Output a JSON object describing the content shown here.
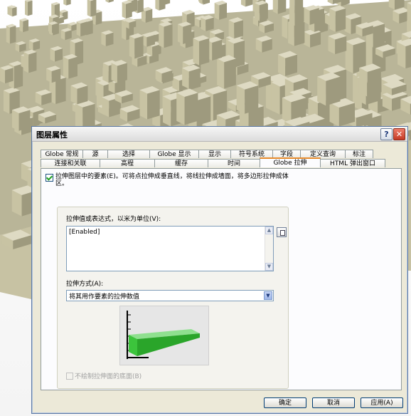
{
  "dialog": {
    "title": "图层属性",
    "help_label": "?",
    "close_label": "✕"
  },
  "tabs": {
    "top_row": [
      "Globe 常规",
      "源",
      "选择",
      "Globe 显示",
      "显示",
      "符号系统",
      "字段",
      "定义查询",
      "标注"
    ],
    "bottom_row": [
      "连接和关联",
      "高程",
      "缓存",
      "时间",
      "Globe 拉伸",
      "HTML 弹出窗口"
    ],
    "active": "Globe 拉伸"
  },
  "extrude": {
    "checkbox_label": "拉伸图层中的要素(E)。可将点拉伸成垂直线，将线拉伸成墙面，将多边形拉伸成体区。",
    "checked": true,
    "value_label": "拉伸值或表达式，以米为单位(V):",
    "value": "[Enabled]",
    "method_label": "拉伸方式(A):",
    "method_value": "将其用作要素的拉伸数值",
    "base_checkbox_label": "不绘制拉伸面的底面(B)",
    "base_checked": false
  },
  "buttons": {
    "ok": "确定",
    "cancel": "取消",
    "apply": "应用(A)"
  },
  "icons": {
    "expression": "expression-builder-icon",
    "scroll_up": "scroll-up-icon",
    "scroll_down": "scroll-down-icon",
    "dropdown": "chevron-down-icon"
  },
  "colors": {
    "active_tab_accent": "#e68b2c",
    "extrusion_green": "#3cc43c",
    "building": "#c8c3a3"
  }
}
